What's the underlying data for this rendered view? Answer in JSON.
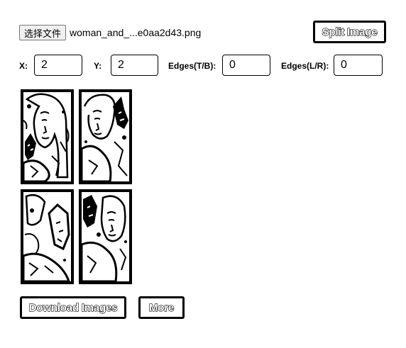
{
  "file_picker": {
    "button_label": "选择文件",
    "file_name": "woman_and_...e0aa2d43.png"
  },
  "split_button_label": "Split Image",
  "params": {
    "x_label": "X:",
    "x_value": "2",
    "y_label": "Y:",
    "y_value": "2",
    "edges_tb_label": "Edges(T/B):",
    "edges_tb_value": "0",
    "edges_lr_label": "Edges(L/R):",
    "edges_lr_value": "0"
  },
  "preview": {
    "tiles": [
      {
        "name": "tile-top-left",
        "content": "woman-and-wolf-illustration"
      },
      {
        "name": "tile-top-right",
        "content": "woman-and-wolf-illustration"
      },
      {
        "name": "tile-bottom-left",
        "content": "woman-and-wolf-illustration"
      },
      {
        "name": "tile-bottom-right",
        "content": "woman-and-wolf-illustration"
      }
    ]
  },
  "actions": {
    "download_label": "Download Images",
    "more_label": "More"
  }
}
